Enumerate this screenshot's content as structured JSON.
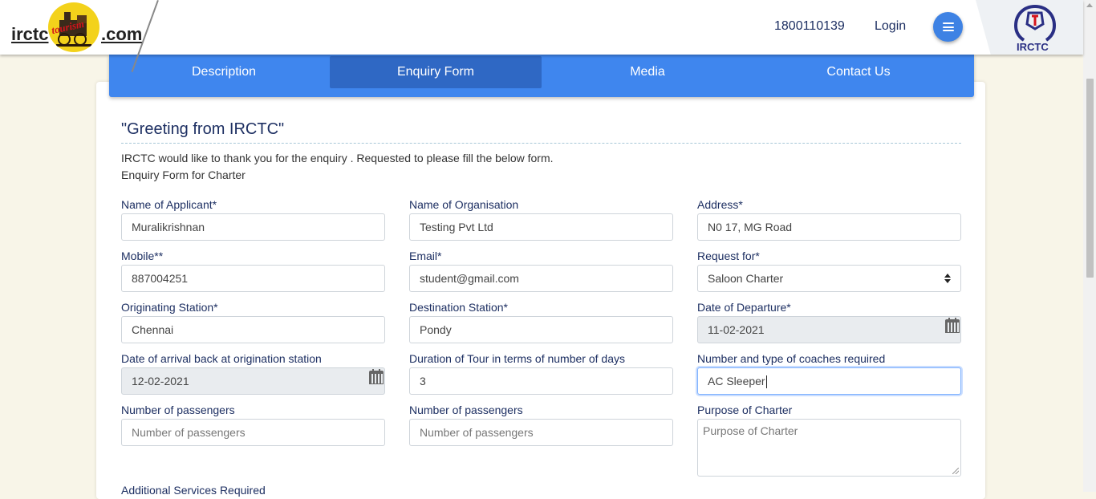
{
  "header": {
    "logo_left": "irctc",
    "logo_right": ".com",
    "logo_badge": "tourism",
    "phone": "1800110139",
    "login_label": "Login",
    "menu_icon": "hamburger-menu-icon",
    "irctc_brand": "IRCTC"
  },
  "tabs": [
    {
      "label": "Description",
      "active": false
    },
    {
      "label": "Enquiry Form",
      "active": true
    },
    {
      "label": "Media",
      "active": false
    },
    {
      "label": "Contact Us",
      "active": false
    }
  ],
  "form": {
    "greeting": "\"Greeting from IRCTC\"",
    "intro": "IRCTC would like to thank you for the enquiry . Requested to please fill the below form.",
    "subtitle": "Enquiry Form for Charter",
    "fields": {
      "applicant": {
        "label": "Name of Applicant*",
        "value": "Muralikrishnan"
      },
      "organisation": {
        "label": "Name of Organisation",
        "value": "Testing Pvt Ltd"
      },
      "address": {
        "label": "Address*",
        "value": "N0 17, MG Road"
      },
      "mobile": {
        "label": "Mobile**",
        "value": "887004251"
      },
      "email": {
        "label": "Email*",
        "value": "student@gmail.com"
      },
      "request_for": {
        "label": "Request for*",
        "value": "Saloon Charter"
      },
      "origin": {
        "label": "Originating Station*",
        "value": "Chennai"
      },
      "destination": {
        "label": "Destination Station*",
        "value": "Pondy"
      },
      "departure": {
        "label": "Date of Departure*",
        "value": "11-02-2021"
      },
      "arrival_back": {
        "label": "Date of arrival back at origination station",
        "value": "12-02-2021"
      },
      "duration": {
        "label": "Duration of Tour in terms of number of days",
        "value": "3"
      },
      "coaches": {
        "label": "Number and type of coaches required",
        "value": "AC Sleeper"
      },
      "passengers_1": {
        "label": "Number of passengers",
        "placeholder": "Number of passengers"
      },
      "passengers_2": {
        "label": "Number of passengers",
        "placeholder": "Number of passengers"
      },
      "purpose": {
        "label": "Purpose of Charter",
        "placeholder": "Purpose of Charter"
      }
    },
    "additional_services": "Additional Services Required"
  }
}
